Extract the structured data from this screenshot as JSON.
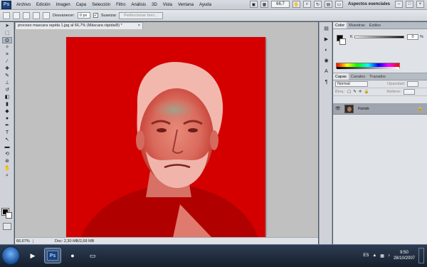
{
  "app": {
    "logo_text": "Ps",
    "menu": [
      "Archivo",
      "Edición",
      "Imagen",
      "Capa",
      "Selección",
      "Filtro",
      "Análisis",
      "3D",
      "Vista",
      "Ventana",
      "Ayuda"
    ],
    "zoom_field": "66,7",
    "workspace": "Aspectos esenciales"
  },
  "options": {
    "feather_label": "Desvanecer:",
    "feather_value": "0 px",
    "smooth_check": "✓",
    "smooth_label": "Suavizar",
    "refine_label": "Perfeccionar borc..."
  },
  "document": {
    "tab_title": "proceso mascara rapida 1.jpg al 66,7% (Máscara rápida/8) *",
    "tab_close": "×",
    "status_zoom": "66,67%",
    "status_doc": "Doc: 2,30 MB/2,68 MB"
  },
  "panels": {
    "color_tabs": [
      "Color",
      "Muestras",
      "Estilos"
    ],
    "color_k": "K",
    "color_value": "0",
    "color_pct": "%",
    "layer_tabs": [
      "Capas",
      "Canales",
      "Trazados"
    ],
    "blend_mode": "Normal",
    "opacity_label": "Opacidad:",
    "lock_label": "Bloq.:",
    "fill_label": "Relleno:",
    "layer_name": "Fondo"
  },
  "taskbar": {
    "lang": "ES",
    "time": "9:50",
    "date": "28/10/2007"
  },
  "colors": {
    "quickmask_red": "#d40000",
    "canvas_bg": "#c0c0c0"
  }
}
